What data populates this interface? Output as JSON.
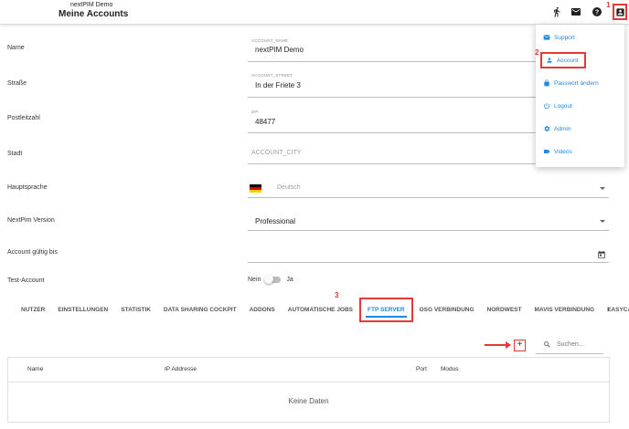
{
  "header": {
    "app_name": "nextPIM Demo",
    "page_title": "Meine Accounts",
    "icons": [
      "run-icon",
      "mail-icon",
      "help-icon",
      "account-icon"
    ]
  },
  "markers": {
    "m1": "1",
    "m2": "2",
    "m3": "3"
  },
  "form": {
    "name": {
      "label": "Name",
      "small": "ACCOUNT_NAME",
      "value": "nextPIM Demo"
    },
    "strasse": {
      "label": "Straße",
      "small": "ACCOUNT_STREET",
      "value": "In der Friete 3"
    },
    "plz": {
      "label": "Postleitzahl",
      "small": "ZIP",
      "value": "48477"
    },
    "stadt": {
      "label": "Stadt",
      "placeholder": "ACCOUNT_CITY"
    },
    "hauptsprache": {
      "label": "Hauptsprache",
      "value": "Deutsch"
    },
    "version": {
      "label": "NextPim Version",
      "value": "Professional"
    },
    "gueltig": {
      "label": "Account gültig bis",
      "value": ""
    },
    "test": {
      "label": "Test-Account",
      "off": "Nein",
      "on": "Ja",
      "checked": false
    }
  },
  "tabs": [
    {
      "label": "NUTZER"
    },
    {
      "label": "EINSTELLUNGEN"
    },
    {
      "label": "STATISTIK"
    },
    {
      "label": "DATA SHARING COCKPIT"
    },
    {
      "label": "ADDONS"
    },
    {
      "label": "AUTOMATISCHE JOBS"
    },
    {
      "label": "FTP SERVER"
    },
    {
      "label": "OSG VERBINDUNG"
    },
    {
      "label": "NORDWEST"
    },
    {
      "label": "MAVIS VERBINDUNG"
    },
    {
      "label": "EASYCATA"
    }
  ],
  "tabs_next": "›",
  "toolbar": {
    "add_label": "+",
    "search_placeholder": "Suchen..."
  },
  "table": {
    "columns": [
      "Name",
      "IP Addresse",
      "Port",
      "Modus"
    ],
    "empty_text": "Keine Daten"
  },
  "menu": [
    {
      "label": "Support",
      "icon": "support-icon"
    },
    {
      "label": "Account",
      "icon": "account-icon"
    },
    {
      "label": "Passwort ändern",
      "icon": "lock-icon"
    },
    {
      "label": "Logout",
      "icon": "power-icon"
    },
    {
      "label": "Admin",
      "icon": "gear-icon"
    },
    {
      "label": "Videos",
      "icon": "video-icon"
    }
  ],
  "colors": {
    "accent": "#1e88e5",
    "highlight": "#e53935"
  }
}
